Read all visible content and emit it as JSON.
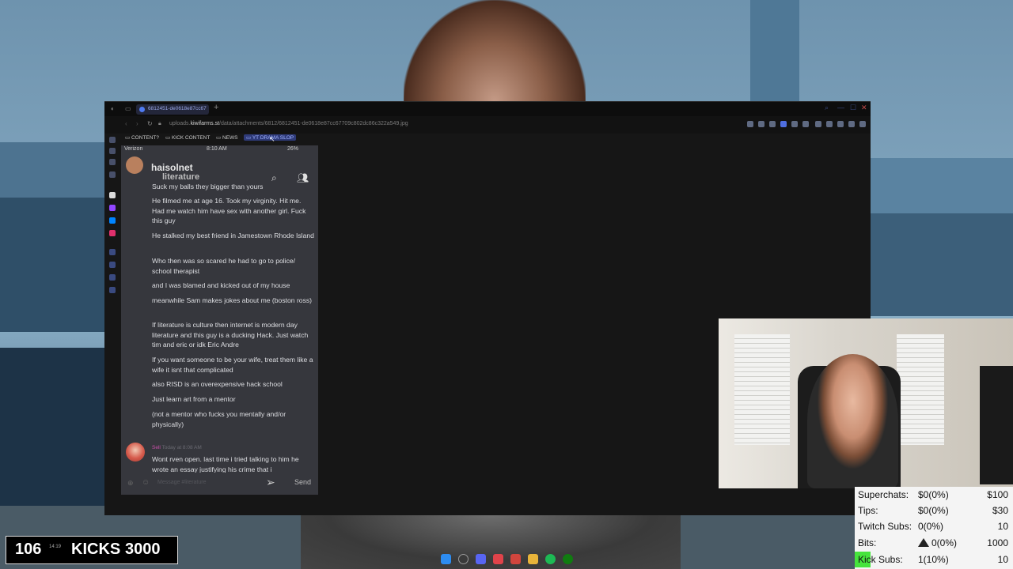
{
  "browser": {
    "tab_title": "6812451-de0618e87cc67",
    "new_tab": "+",
    "url_prefix": "uploads.",
    "url_host": "kiwifarms.st",
    "url_path": "/data/attachments/6812/6812451-de0618e87cc67709c802dc86c322a549.jpg",
    "bookmarks": [
      "CONTENT?",
      "KICK CONTENT",
      "NEWS",
      "YT DRAMA SLOP"
    ],
    "active_bookmark": "YT DRAMA SLOP"
  },
  "discord": {
    "status_carrier": "Verizon",
    "status_time": "8:10 AM",
    "status_battery": "26%",
    "username": "haisolnet",
    "channel": "literature",
    "messages": [
      "Suck my balls they bigger than yours",
      "He filmed me at age 16. Took my virginity. Hit me. Had me watch him have sex with another girl. Fuck this guy",
      "He stalked my best friend in Jamestown Rhode Island",
      "Who then was so scared he had to go to police/ school therapist",
      "and I was blamed and kicked out of my house",
      "meanwhile Sam makes jokes about me (boston ross)",
      "If literature is culture then internet is modern day literature and this guy is a ducking Hack. Just watch tim and eric or idk Eric Andre",
      "If you want someone to be your wife, treat them like a wife it isnt that complicated",
      "also RISD is an overexpensive hack school",
      "Just learn art from a mentor",
      "(not a mentor who fucks you mentally and/or physically)"
    ],
    "reply_name": "Sell",
    "reply_time": "Today at 8:08 AM",
    "reply_text": "Wont rven open. last time i tried talking to him he wrote an essay justifying his crime that i",
    "input_placeholder": "Message #literature",
    "send_label": "Send"
  },
  "stats": {
    "rows": [
      {
        "label": "Superchats:",
        "current": "$0(0%)",
        "goal": "$100"
      },
      {
        "label": "Tips:",
        "current": "$0(0%)",
        "goal": "$30"
      },
      {
        "label": "Twitch Subs:",
        "current": "0(0%)",
        "goal": "10"
      },
      {
        "label": "Bits:",
        "current": "0(0%)",
        "goal": "1000"
      },
      {
        "label": "Kick Subs:",
        "current": "1(10%)",
        "goal": "10"
      }
    ]
  },
  "kick_counter": {
    "count": "106",
    "timer": "14:19",
    "label": "KICKS",
    "goal": "3000"
  },
  "colors": {
    "kick_green": "#46e43c",
    "discord_bg": "#36373d",
    "active_bookmark": "#2e3a78"
  }
}
